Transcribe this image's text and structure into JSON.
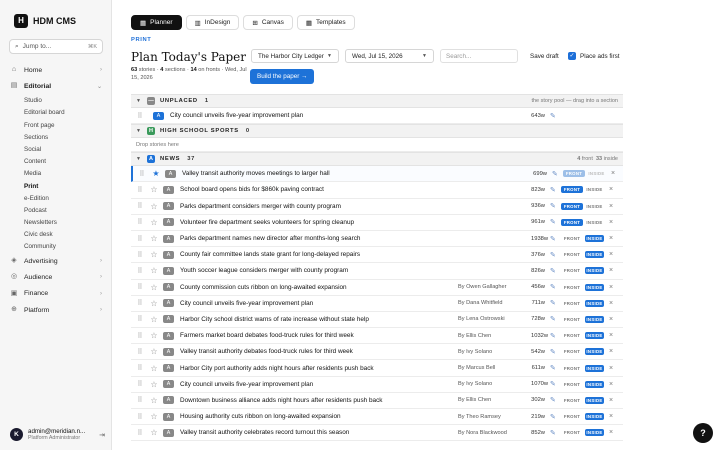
{
  "app": {
    "logo_letter": "H",
    "name": "HDM CMS"
  },
  "jump": {
    "placeholder": "Jump to...",
    "shortcut": "⌘K"
  },
  "nav": {
    "home": "Home",
    "editorial": "Editorial",
    "editorial_items": [
      "Studio",
      "Editorial board",
      "Front page",
      "Sections",
      "Social",
      "Content",
      "Media",
      "Print",
      "e-Edition",
      "Podcast",
      "Newsletters",
      "Civic desk",
      "Community"
    ],
    "advertising": "Advertising",
    "audience": "Audience",
    "finance": "Finance",
    "platform": "Platform"
  },
  "user": {
    "initial": "K",
    "email": "admin@meridian.n...",
    "role": "Platform Administrator"
  },
  "tabs": [
    "Planner",
    "InDesign",
    "Canvas",
    "Templates"
  ],
  "page": {
    "eyebrow": "PRINT",
    "title": "Plan Today's Paper",
    "stats": {
      "stories": "63",
      "stories_label": "stories ·",
      "sections": "4",
      "sections_label": "sections ·",
      "fronts": "14",
      "fronts_label": "on fronts · Wed, Jul 15, 2026"
    },
    "paper_select": "The Harbor City Ledger",
    "date_select": "Wed, Jul 15, 2026",
    "search_placeholder": "Search...",
    "save_draft": "Save draft",
    "place_ads_first": "Place ads first",
    "build_button": "Build the paper →"
  },
  "labels": {
    "front": "FRONT",
    "inside": "INSIDE"
  },
  "sections": {
    "unplaced": {
      "badge": "—",
      "name": "UNPLACED",
      "count": "1",
      "hint": "the story pool — drag into a section"
    },
    "high_school": {
      "badge": "H",
      "name": "HIGH SCHOOL SPORTS",
      "count": "0",
      "empty": "Drop stories here"
    },
    "news": {
      "badge": "A",
      "name": "NEWS",
      "count": "37",
      "front_count": "4",
      "front_label": "front",
      "inside_count": "33",
      "inside_label": "inside"
    }
  },
  "unplaced_rows": [
    {
      "pri": "A",
      "headline": "City council unveils five-year improvement plan",
      "words": "643w"
    }
  ],
  "news_rows": [
    {
      "pri": "A",
      "headline": "Valley transit authority moves meetings to larger hall",
      "byline": "",
      "words": "699w",
      "starred": true,
      "front": "faded",
      "inside": "dim",
      "sel": true
    },
    {
      "pri": "A",
      "headline": "School board opens bids for $860k paving contract",
      "byline": "",
      "words": "823w",
      "starred": false,
      "front": "on",
      "inside": "off"
    },
    {
      "pri": "A",
      "headline": "Parks department considers merger with county program",
      "byline": "",
      "words": "936w",
      "starred": false,
      "front": "on",
      "inside": "off"
    },
    {
      "pri": "A",
      "headline": "Volunteer fire department seeks volunteers for spring cleanup",
      "byline": "",
      "words": "961w",
      "starred": false,
      "front": "on",
      "inside": "off"
    },
    {
      "pri": "A",
      "headline": "Parks department names new director after months-long search",
      "byline": "",
      "words": "1938w",
      "starred": false,
      "front": "off",
      "inside": "on"
    },
    {
      "pri": "A",
      "headline": "County fair committee lands state grant for long-delayed repairs",
      "byline": "",
      "words": "376w",
      "starred": false,
      "front": "off",
      "inside": "on"
    },
    {
      "pri": "A",
      "headline": "Youth soccer league considers merger with county program",
      "byline": "",
      "words": "826w",
      "starred": false,
      "front": "off",
      "inside": "on"
    },
    {
      "pri": "A",
      "headline": "County commission cuts ribbon on long-awaited expansion",
      "byline": "By Owen Gallagher",
      "words": "456w",
      "starred": false,
      "front": "off",
      "inside": "on"
    },
    {
      "pri": "A",
      "headline": "City council unveils five-year improvement plan",
      "byline": "By Dana Whitfield",
      "words": "711w",
      "starred": false,
      "front": "off",
      "inside": "on"
    },
    {
      "pri": "A",
      "headline": "Harbor City school district warns of rate increase without state help",
      "byline": "By Lena Ostrowski",
      "words": "728w",
      "starred": false,
      "front": "off",
      "inside": "on"
    },
    {
      "pri": "A",
      "headline": "Farmers market board debates food-truck rules for third week",
      "byline": "By Ellis Chen",
      "words": "1032w",
      "starred": false,
      "front": "off",
      "inside": "on"
    },
    {
      "pri": "A",
      "headline": "Valley transit authority debates food-truck rules for third week",
      "byline": "By Ivy Solano",
      "words": "542w",
      "starred": false,
      "front": "off",
      "inside": "on"
    },
    {
      "pri": "A",
      "headline": "Harbor City port authority adds night hours after residents push back",
      "byline": "By Marcus Bell",
      "words": "611w",
      "starred": false,
      "front": "off",
      "inside": "on"
    },
    {
      "pri": "A",
      "headline": "City council unveils five-year improvement plan",
      "byline": "By Ivy Solano",
      "words": "1070w",
      "starred": false,
      "front": "off",
      "inside": "on"
    },
    {
      "pri": "A",
      "headline": "Downtown business alliance adds night hours after residents push back",
      "byline": "By Ellis Chen",
      "words": "302w",
      "starred": false,
      "front": "off",
      "inside": "on"
    },
    {
      "pri": "A",
      "headline": "Housing authority cuts ribbon on long-awaited expansion",
      "byline": "By Theo Ramsey",
      "words": "219w",
      "starred": false,
      "front": "off",
      "inside": "on"
    },
    {
      "pri": "A",
      "headline": "Valley transit authority celebrates record turnout this season",
      "byline": "By Nora Blackwood",
      "words": "852w",
      "starred": false,
      "front": "off",
      "inside": "on"
    }
  ],
  "help": "?",
  "icons": {
    "drag": "grip-icon",
    "star": "star-icon",
    "edit": "edit-icon",
    "remove": "close-icon"
  },
  "colors": {
    "accent": "#1d72d8",
    "dark": "#111111"
  }
}
